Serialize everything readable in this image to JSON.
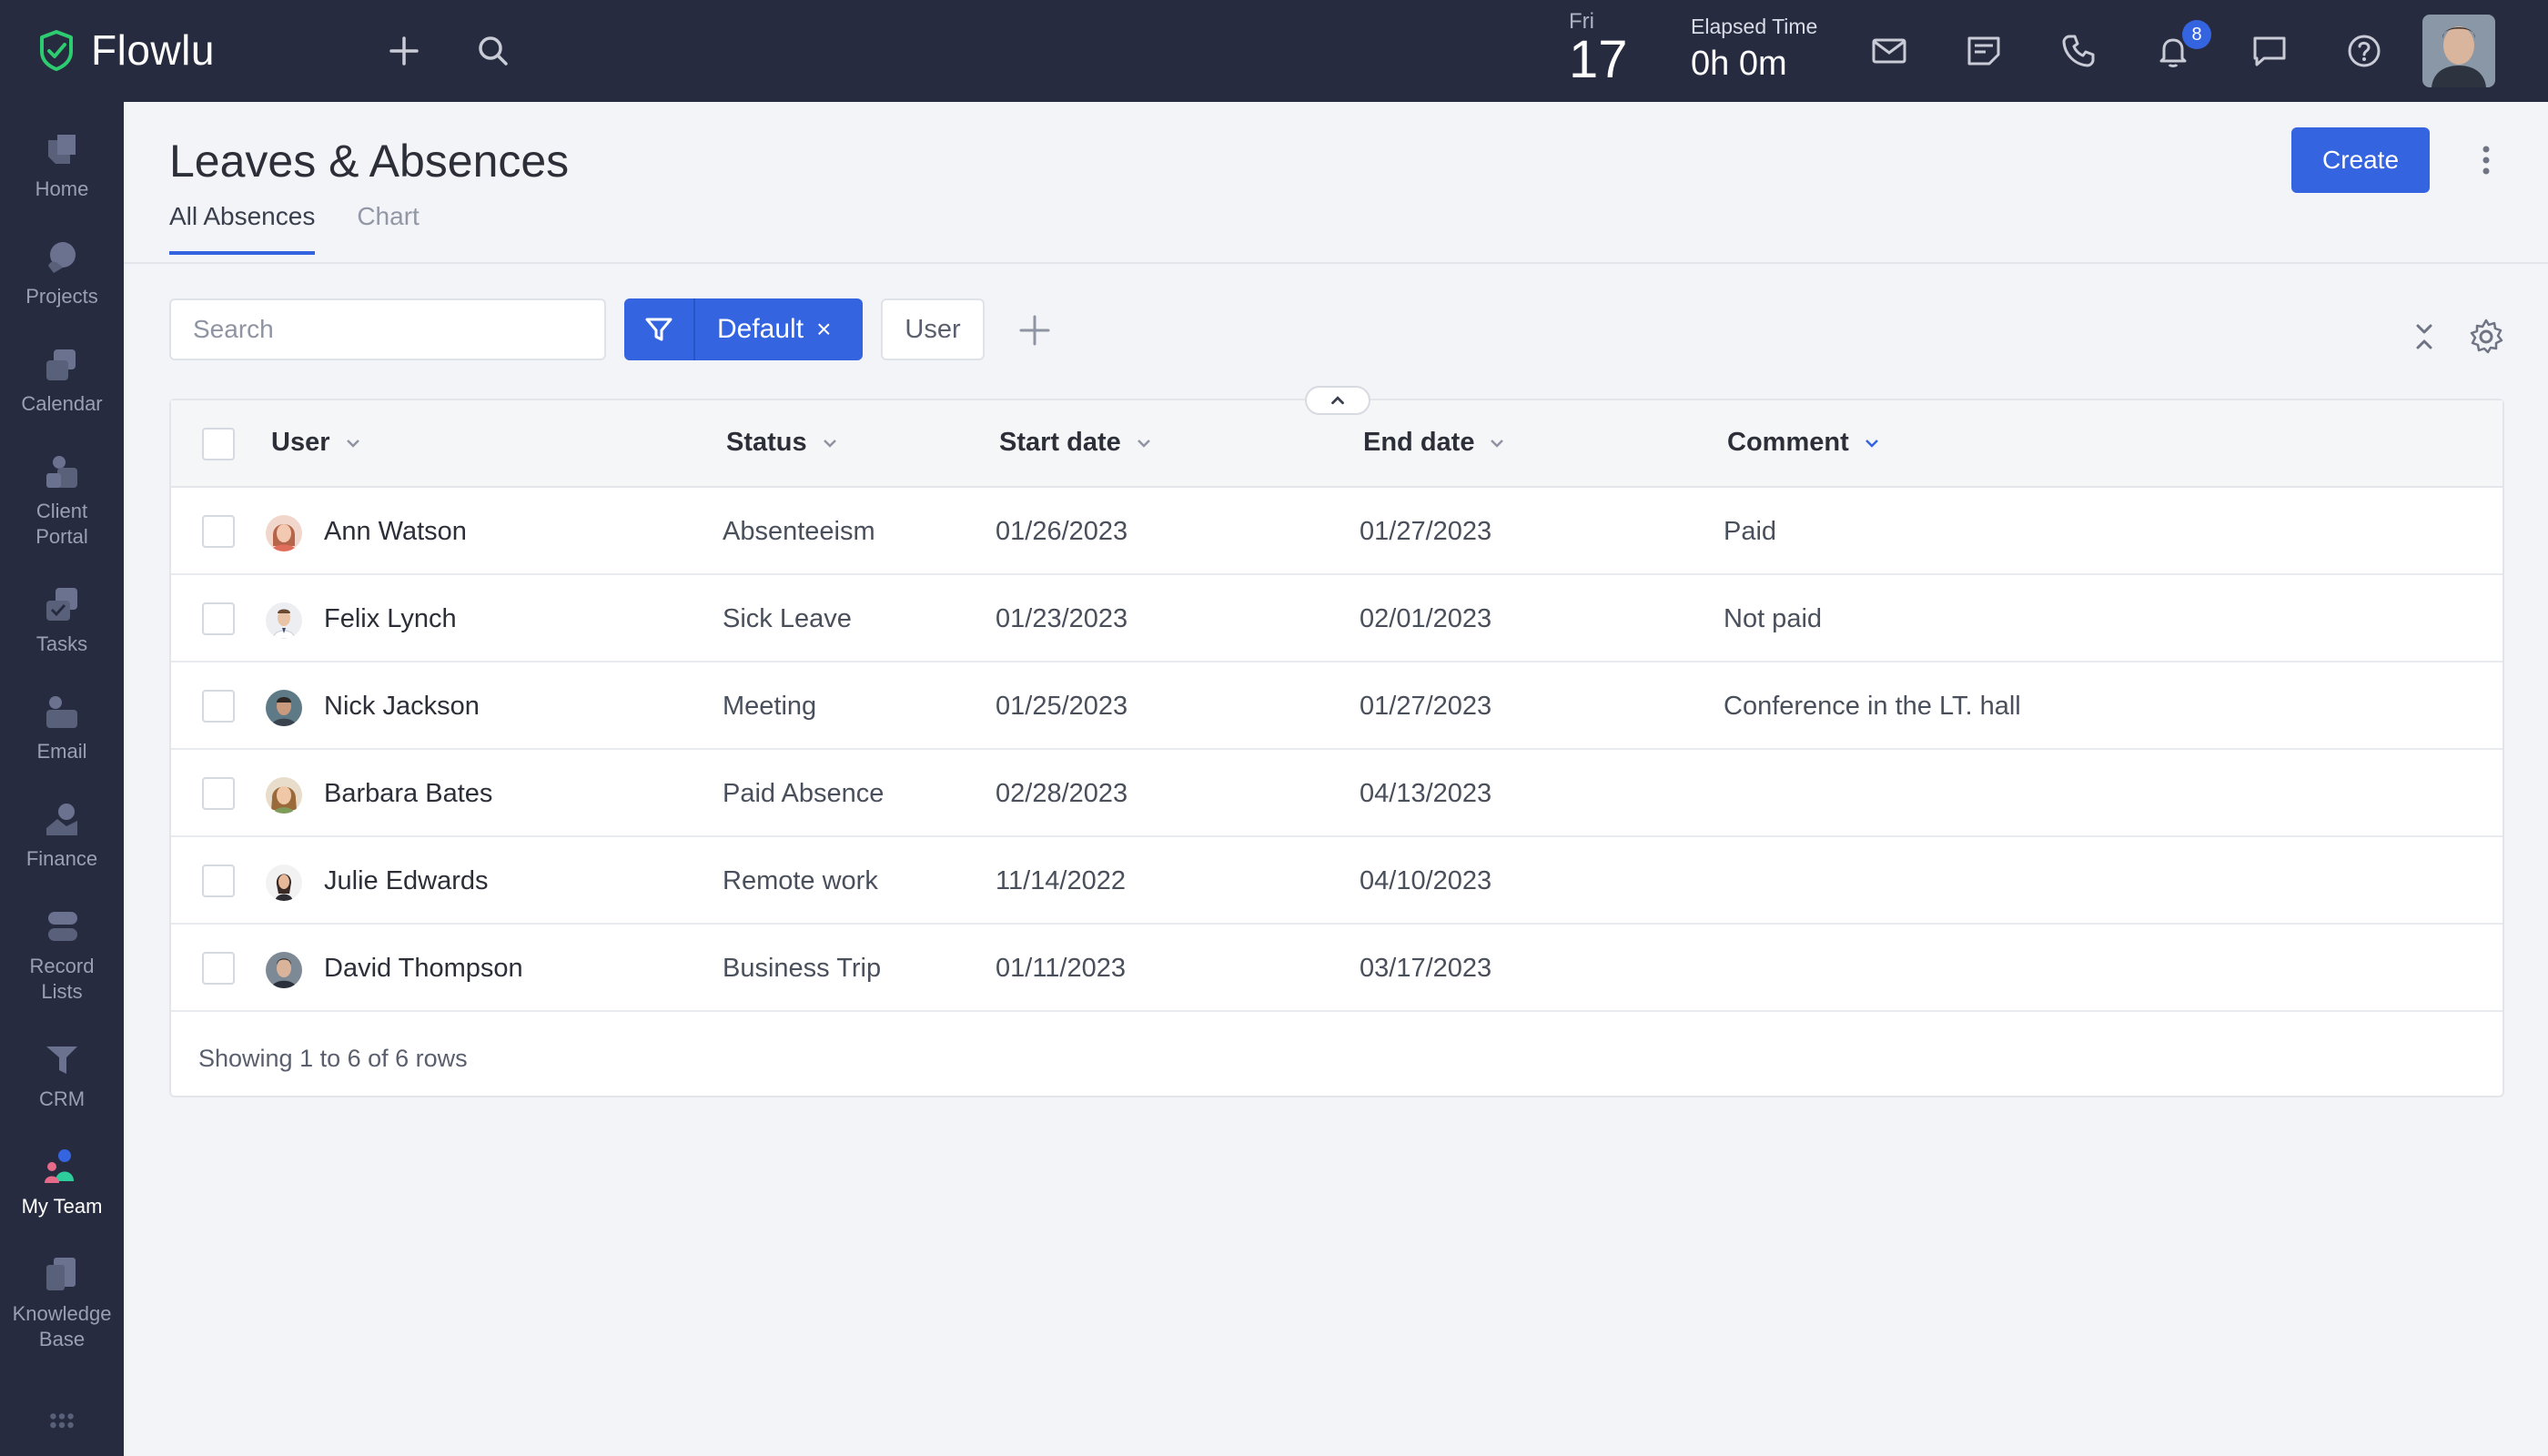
{
  "app": {
    "name": "Flowlu"
  },
  "topbar": {
    "day_name": "Fri",
    "day_number": "17",
    "elapsed_label": "Elapsed Time",
    "elapsed_value": "0h 0m",
    "notifications_count": "8",
    "icons": [
      "plus-icon",
      "search-icon",
      "mail-icon",
      "notes-icon",
      "phone-icon",
      "bell-icon",
      "chat-icon",
      "help-icon"
    ]
  },
  "sidebar": {
    "items": [
      {
        "label": "Home",
        "icon": "home-icon"
      },
      {
        "label": "Projects",
        "icon": "projects-icon"
      },
      {
        "label": "Calendar",
        "icon": "calendar-icon"
      },
      {
        "label": "Client\nPortal",
        "icon": "client-portal-icon"
      },
      {
        "label": "Tasks",
        "icon": "tasks-icon"
      },
      {
        "label": "Email",
        "icon": "email-icon"
      },
      {
        "label": "Finance",
        "icon": "finance-icon"
      },
      {
        "label": "Record\nLists",
        "icon": "record-lists-icon"
      },
      {
        "label": "CRM",
        "icon": "crm-icon"
      },
      {
        "label": "My Team",
        "icon": "my-team-icon",
        "active": true
      },
      {
        "label": "Knowledge\nBase",
        "icon": "knowledge-base-icon"
      }
    ]
  },
  "page": {
    "title": "Leaves & Absences",
    "create_label": "Create",
    "tabs": [
      {
        "label": "All Absences",
        "active": true
      },
      {
        "label": "Chart",
        "active": false
      }
    ]
  },
  "filters": {
    "search_placeholder": "Search",
    "preset_label": "Default",
    "preset_close": "×",
    "user_chip": "User"
  },
  "table": {
    "columns": [
      "User",
      "Status",
      "Start date",
      "End date",
      "Comment"
    ],
    "rows": [
      {
        "user": "Ann Watson",
        "status": "Absenteeism",
        "start": "01/26/2023",
        "end": "01/27/2023",
        "comment": "Paid"
      },
      {
        "user": "Felix Lynch",
        "status": "Sick Leave",
        "start": "01/23/2023",
        "end": "02/01/2023",
        "comment": "Not paid"
      },
      {
        "user": "Nick Jackson",
        "status": "Meeting",
        "start": "01/25/2023",
        "end": "01/27/2023",
        "comment": "Conference in the LT. hall"
      },
      {
        "user": "Barbara Bates",
        "status": "Paid Absence",
        "start": "02/28/2023",
        "end": "04/13/2023",
        "comment": ""
      },
      {
        "user": "Julie Edwards",
        "status": "Remote work",
        "start": "11/14/2022",
        "end": "04/10/2023",
        "comment": ""
      },
      {
        "user": "David Thompson",
        "status": "Business Trip",
        "start": "01/11/2023",
        "end": "03/17/2023",
        "comment": ""
      }
    ],
    "footer": "Showing 1 to 6 of 6 rows"
  },
  "colors": {
    "topbar_bg": "#272b3f",
    "accent": "#3464e0",
    "page_bg": "#f3f4f7"
  }
}
